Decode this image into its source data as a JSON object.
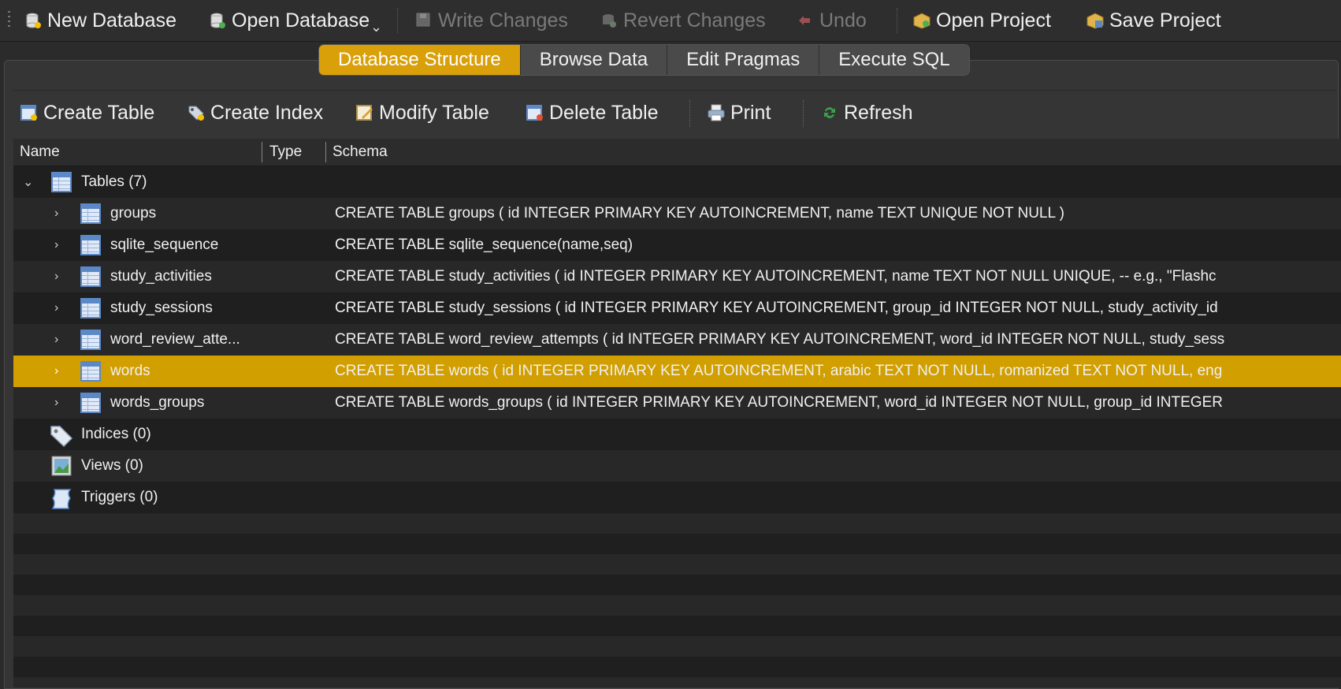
{
  "toolbar": {
    "new_db": "New Database",
    "open_db": "Open Database",
    "write_changes": "Write Changes",
    "revert_changes": "Revert Changes",
    "undo": "Undo",
    "open_project": "Open Project",
    "save_project": "Save Project"
  },
  "tabs": [
    "Database Structure",
    "Browse Data",
    "Edit Pragmas",
    "Execute SQL"
  ],
  "structure_toolbar": {
    "create_table": "Create Table",
    "create_index": "Create Index",
    "modify_table": "Modify Table",
    "delete_table": "Delete Table",
    "print": "Print",
    "refresh": "Refresh"
  },
  "columns": {
    "name": "Name",
    "type": "Type",
    "schema": "Schema"
  },
  "tree": {
    "tables_label": "Tables (7)",
    "tables": [
      {
        "name": "groups",
        "schema": "CREATE TABLE groups ( id INTEGER PRIMARY KEY AUTOINCREMENT, name TEXT UNIQUE NOT NULL )"
      },
      {
        "name": "sqlite_sequence",
        "schema": "CREATE TABLE sqlite_sequence(name,seq)"
      },
      {
        "name": "study_activities",
        "schema": "CREATE TABLE study_activities ( id INTEGER PRIMARY KEY AUTOINCREMENT, name TEXT NOT NULL UNIQUE, -- e.g., \"Flashc"
      },
      {
        "name": "study_sessions",
        "schema": "CREATE TABLE study_sessions ( id INTEGER PRIMARY KEY AUTOINCREMENT, group_id INTEGER NOT NULL, study_activity_id"
      },
      {
        "name": "word_review_atte...",
        "schema": "CREATE TABLE word_review_attempts ( id INTEGER PRIMARY KEY AUTOINCREMENT, word_id INTEGER NOT NULL, study_sess"
      },
      {
        "name": "words",
        "schema": "CREATE TABLE words ( id INTEGER PRIMARY KEY AUTOINCREMENT, arabic TEXT NOT NULL, romanized TEXT NOT NULL, eng"
      },
      {
        "name": "words_groups",
        "schema": "CREATE TABLE words_groups ( id INTEGER PRIMARY KEY AUTOINCREMENT, word_id INTEGER NOT NULL, group_id INTEGER"
      }
    ],
    "indices_label": "Indices (0)",
    "views_label": "Views (0)",
    "triggers_label": "Triggers (0)"
  },
  "colors": {
    "accent": "#d29f00",
    "background": "#1f1f1f"
  }
}
